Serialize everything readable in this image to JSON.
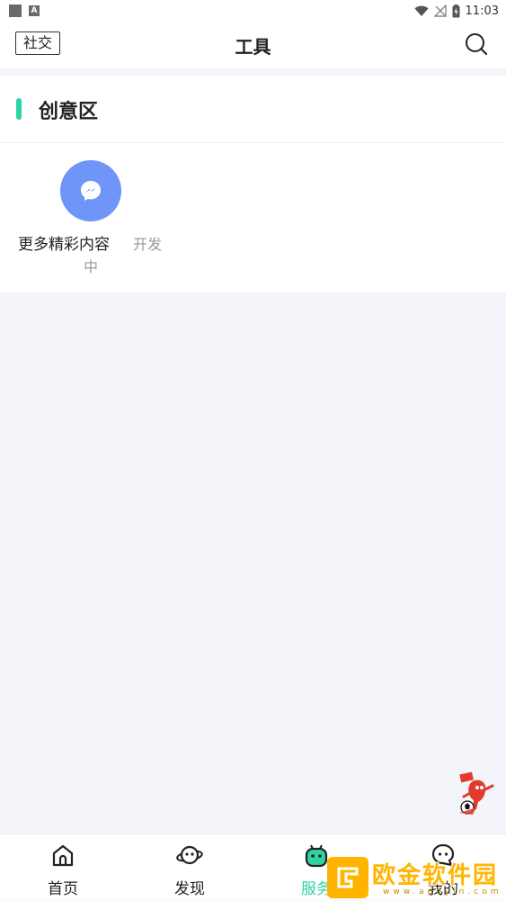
{
  "status_bar": {
    "time": "11:03",
    "indicator_letter": "A"
  },
  "header": {
    "social_label": "社交",
    "title": "工具"
  },
  "creative_section": {
    "title": "创意区",
    "items": [
      {
        "name": "更多精彩内容",
        "status_part1": "开发",
        "status_part2": "中",
        "icon": "messenger-icon"
      }
    ]
  },
  "bottom_nav": {
    "items": [
      {
        "label": "首页",
        "icon": "home-icon",
        "active": false
      },
      {
        "label": "发现",
        "icon": "planet-icon",
        "active": false
      },
      {
        "label": "服务",
        "icon": "robot-icon",
        "active": true
      },
      {
        "label": "我的",
        "icon": "chat-face-icon",
        "active": false
      }
    ]
  },
  "watermark": {
    "name": "欧金软件园",
    "url": "www.apoyin.com"
  },
  "colors": {
    "accent": "#2ed3a4",
    "tool_icon_bg": "#6f95f8",
    "watermark": "#ffb400",
    "page_bg": "#f4f5fa"
  }
}
